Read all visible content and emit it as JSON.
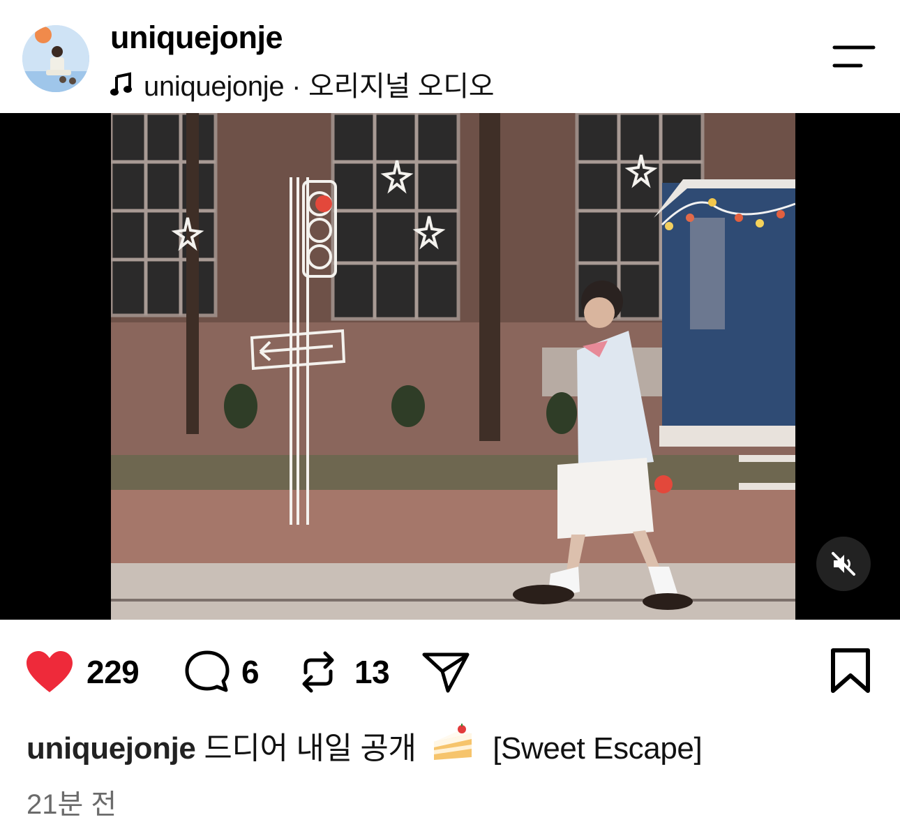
{
  "header": {
    "username": "uniquejonje",
    "audio_label": "uniquejonje · 오리지널 오디오"
  },
  "video": {
    "muted": true
  },
  "actions": {
    "likes": "229",
    "comments": "6",
    "reposts": "13"
  },
  "caption": {
    "username": "uniquejonje",
    "text": "드디어 내일 공개",
    "emoji_icon": "cake-icon",
    "tag": "[Sweet Escape]"
  },
  "timestamp": "21분 전",
  "colors": {
    "like": "#ee2a3a",
    "muted_text": "#6b6b6b",
    "video_bg": "#000000"
  }
}
